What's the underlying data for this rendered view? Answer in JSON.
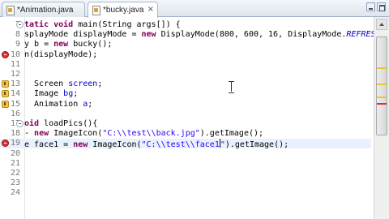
{
  "tabs": [
    {
      "label": "*Animation.java",
      "close": "×"
    },
    {
      "label": "*bucky.java",
      "close": "×"
    }
  ],
  "lines": [
    {
      "no": "7",
      "segments": [
        {
          "t": "tatic ",
          "c": "kw"
        },
        {
          "t": "void",
          "c": "kw"
        },
        {
          "t": " main(String args[]) {",
          "c": ""
        }
      ]
    },
    {
      "no": "8",
      "segments": [
        {
          "t": "splayMode displayMode = ",
          "c": ""
        },
        {
          "t": "new",
          "c": "kw"
        },
        {
          "t": " DisplayMode(800, 600, 16, DisplayMode.",
          "c": ""
        },
        {
          "t": "REFRESH",
          "c": "itf"
        }
      ]
    },
    {
      "no": "9",
      "segments": [
        {
          "t": "y b = ",
          "c": ""
        },
        {
          "t": "new",
          "c": "kw"
        },
        {
          "t": " bucky();",
          "c": ""
        }
      ]
    },
    {
      "no": "10",
      "segments": [
        {
          "t": "n(displayMode);",
          "c": ""
        }
      ]
    },
    {
      "no": "11",
      "segments": [
        {
          "t": "",
          "c": ""
        }
      ]
    },
    {
      "no": "12",
      "segments": [
        {
          "t": "",
          "c": ""
        }
      ]
    },
    {
      "no": "13",
      "segments": [
        {
          "t": "  Screen ",
          "c": ""
        },
        {
          "t": "screen",
          "c": "fld"
        },
        {
          "t": ";",
          "c": ""
        }
      ]
    },
    {
      "no": "14",
      "segments": [
        {
          "t": "  Image ",
          "c": ""
        },
        {
          "t": "bg",
          "c": "fld"
        },
        {
          "t": ";",
          "c": ""
        }
      ]
    },
    {
      "no": "15",
      "segments": [
        {
          "t": "  Animation ",
          "c": ""
        },
        {
          "t": "a",
          "c": "fld"
        },
        {
          "t": ";",
          "c": ""
        }
      ]
    },
    {
      "no": "16",
      "segments": [
        {
          "t": "",
          "c": ""
        }
      ]
    },
    {
      "no": "17",
      "segments": [
        {
          "t": "oid",
          "c": "kw"
        },
        {
          "t": " loadPics(){",
          "c": ""
        }
      ]
    },
    {
      "no": "18",
      "segments": [
        {
          "t": "- ",
          "c": ""
        },
        {
          "t": "new",
          "c": "kw"
        },
        {
          "t": " ImageIcon(",
          "c": ""
        },
        {
          "t": "\"C:\\\\test\\\\back.jpg\"",
          "c": "str"
        },
        {
          "t": ").getImage();",
          "c": ""
        }
      ]
    },
    {
      "no": "19",
      "segments": [
        {
          "t": "e face1 = ",
          "c": ""
        },
        {
          "t": "new",
          "c": "kw"
        },
        {
          "t": " ImageIcon(",
          "c": ""
        },
        {
          "t": "\"C:\\\\test\\\\face1",
          "c": "str"
        },
        {
          "t": "\"",
          "c": "str"
        },
        {
          "t": ").getImage();",
          "c": ""
        }
      ]
    },
    {
      "no": "20",
      "segments": [
        {
          "t": "",
          "c": ""
        }
      ]
    },
    {
      "no": "21",
      "segments": [
        {
          "t": "",
          "c": ""
        }
      ]
    },
    {
      "no": "22",
      "segments": [
        {
          "t": "",
          "c": ""
        }
      ]
    },
    {
      "no": "23",
      "segments": [
        {
          "t": "",
          "c": ""
        }
      ]
    },
    {
      "no": "24",
      "segments": [
        {
          "t": "",
          "c": ""
        }
      ]
    }
  ],
  "current_line": "19",
  "colors": {
    "keyword": "#7f0055",
    "string": "#2a00ff",
    "field": "#0000c0",
    "current_line": "#e8f2fe"
  }
}
